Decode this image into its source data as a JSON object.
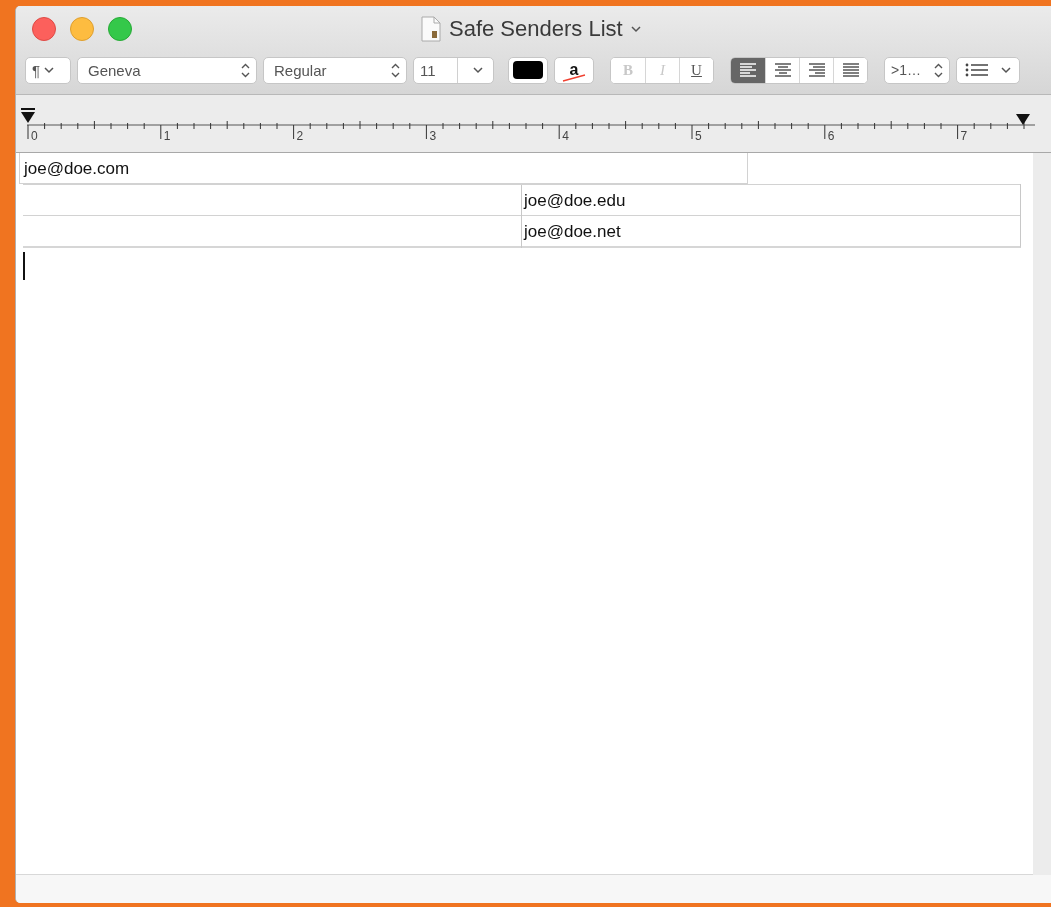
{
  "window": {
    "title": "Safe Senders List"
  },
  "toolbar": {
    "paragraph_style": {
      "label": "¶"
    },
    "font_family": {
      "value": "Geneva"
    },
    "typeface": {
      "value": "Regular"
    },
    "font_size": {
      "value": "11"
    },
    "text_color": {
      "color": "#000000"
    },
    "background_color": {
      "label": "a"
    },
    "styles": [
      {
        "label": "B",
        "disabled": true
      },
      {
        "label": "I",
        "disabled": true
      },
      {
        "label": "U",
        "disabled": false
      }
    ],
    "alignment": [
      {
        "kind": "left",
        "selected": true
      },
      {
        "kind": "center",
        "selected": false
      },
      {
        "kind": "right",
        "selected": false
      },
      {
        "kind": "justify",
        "selected": false
      }
    ],
    "spacing": {
      "value": ">1…"
    },
    "lists": {
      "kind": "bullets"
    }
  },
  "ruler": {
    "labels": [
      "0",
      "1",
      "2",
      "3",
      "4",
      "5",
      "6",
      "7"
    ]
  },
  "document": {
    "tables": [
      {
        "rows": [
          [
            "joe@doe.com"
          ]
        ]
      },
      {
        "rows": [
          {
            "column_2": "joe@doe.edu"
          },
          {
            "column_2": "joe@doe.net"
          }
        ]
      }
    ]
  }
}
